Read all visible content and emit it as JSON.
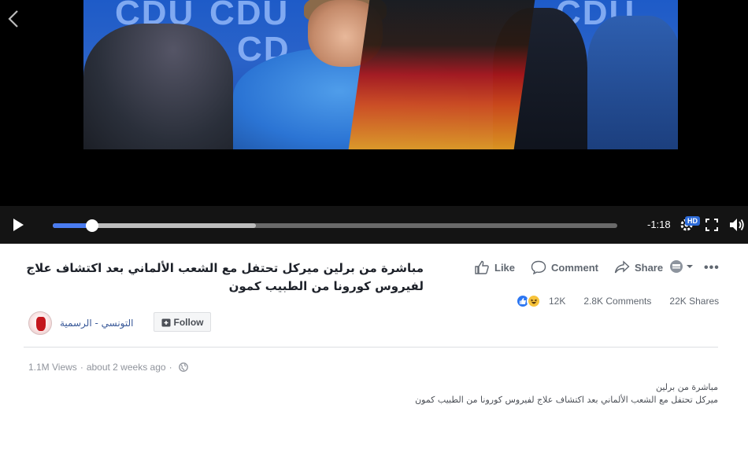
{
  "video": {
    "frame_text": [
      "CDU",
      "CDU",
      "CD",
      "CDU"
    ],
    "time_remaining": "-1:18",
    "hd_label": "HD",
    "progress_played": 0.07,
    "progress_buffered": 0.36
  },
  "post": {
    "title": "مباشرة من برلين ميركل تحتفل مع الشعب الألماني بعد اكتشاف علاج لفيروس كورونا من الطبيب كمون",
    "actions": {
      "like": "Like",
      "comment": "Comment",
      "share": "Share"
    },
    "stats": {
      "reactions": "12K",
      "comments": "2.8K Comments",
      "shares": "22K Shares"
    },
    "page_name": "التونسي - الرسمية",
    "follow_label": "Follow",
    "views": "1.1M Views",
    "separator": "·",
    "time_ago": "about 2 weeks ago",
    "description_lines": [
      "مباشرة من برلين",
      "ميركل تحتفل مع الشعب الألماني بعد اكتشاف علاج لفيروس كورونا من الطبيب كمون"
    ]
  },
  "colors": {
    "accent": "#4a7cf0",
    "link": "#385898",
    "text": "#1d2129",
    "muted": "#606770"
  }
}
